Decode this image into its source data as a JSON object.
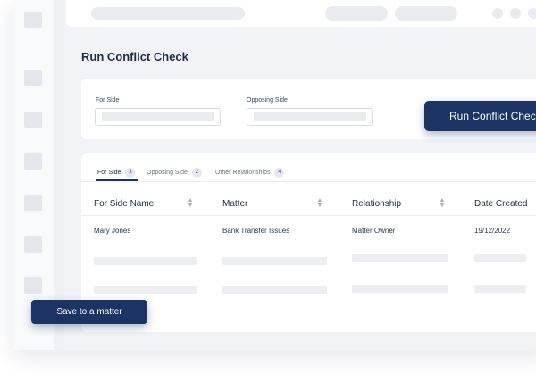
{
  "page": {
    "title": "Run Conflict Check"
  },
  "filters": {
    "for_side_label": "For Side",
    "opposing_side_label": "Opposing Side",
    "run_button_label": "Run Conflict Check"
  },
  "tabs": [
    {
      "label": "For Side",
      "count": "3"
    },
    {
      "label": "Opposing Side",
      "count": "2"
    },
    {
      "label": "Other Relationships",
      "count": "4"
    }
  ],
  "table": {
    "columns": [
      "For Side Name",
      "Matter",
      "Relationship",
      "Date Created"
    ],
    "rows": [
      [
        "Mary Jones",
        "Bank Transfer Issues",
        "Matter Owner",
        "19/12/2022"
      ]
    ]
  },
  "actions": {
    "save_button_label": "Save to a matter"
  },
  "icons": {
    "sort": "sort-icon"
  },
  "colors": {
    "primary": "#1c3463",
    "background": "#f2f3f6"
  }
}
